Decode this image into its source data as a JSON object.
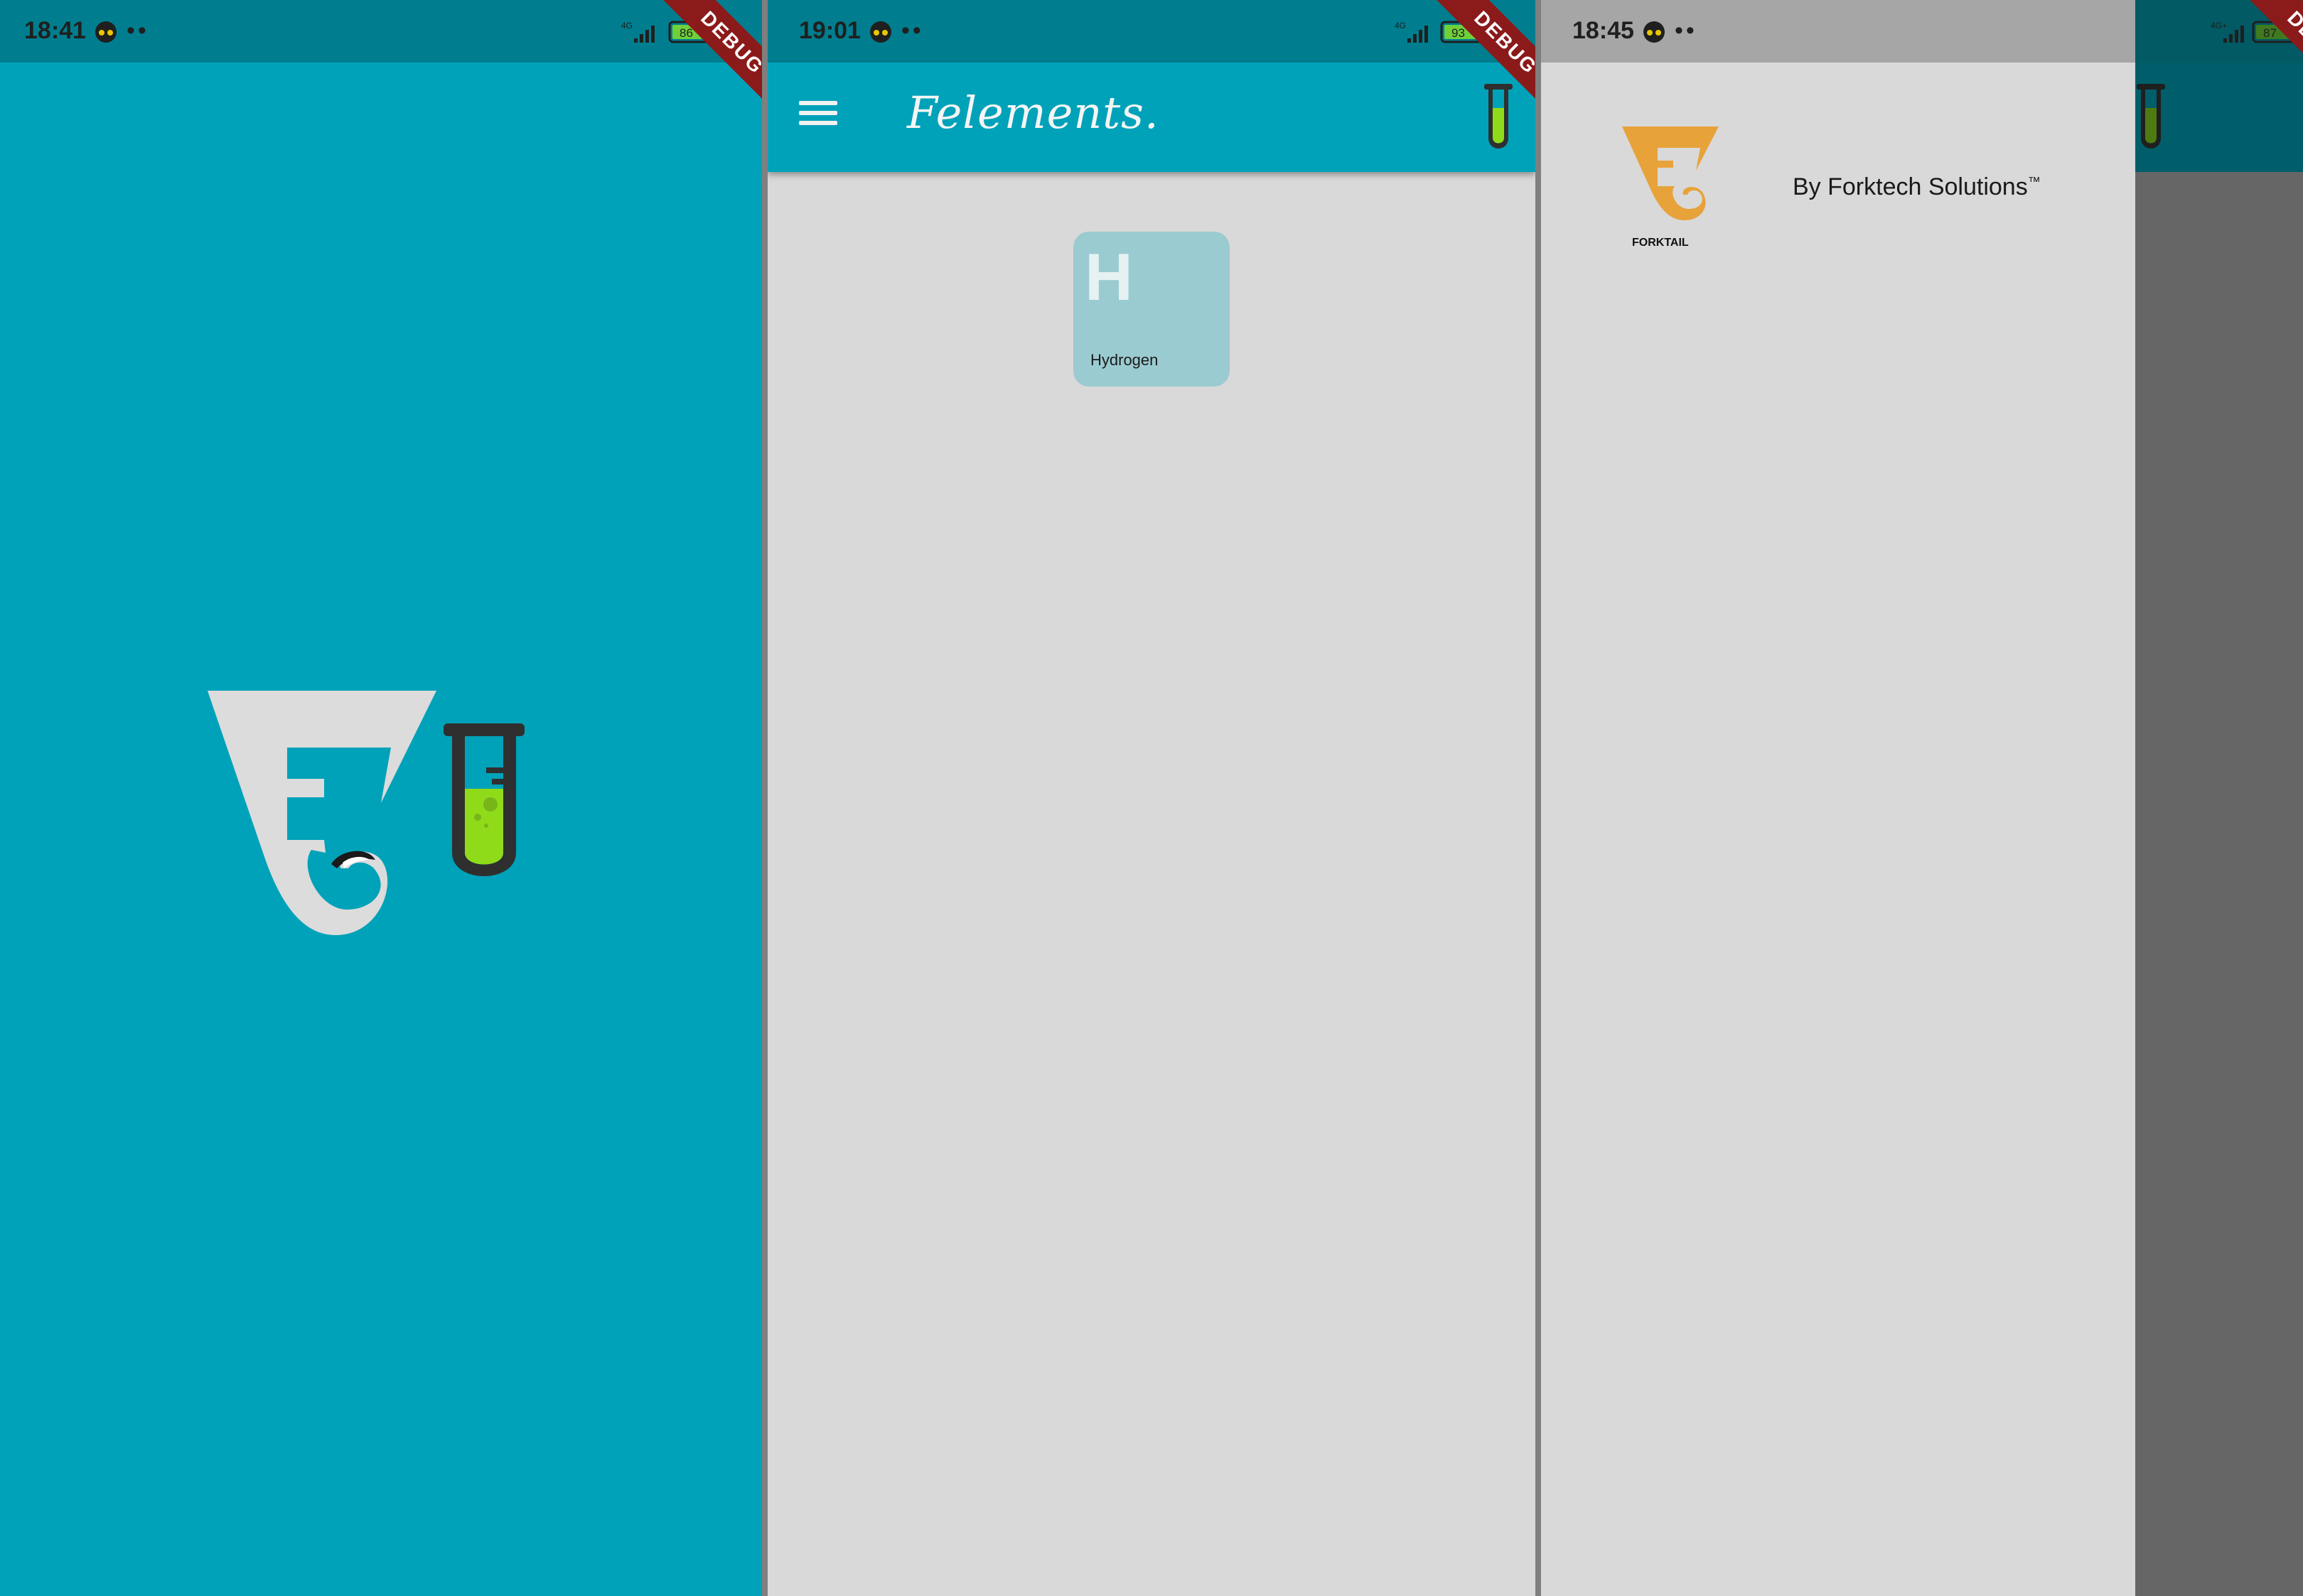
{
  "screens": [
    {
      "name": "splash",
      "status": {
        "time": "18:41",
        "dots": "••",
        "network": "4G",
        "battery": "86"
      },
      "debug_banner": "DEBUG"
    },
    {
      "name": "home",
      "status": {
        "time": "19:01",
        "dots": "••",
        "network": "4G",
        "battery": "93"
      },
      "debug_banner": "DEBUG",
      "appbar": {
        "title": "Felements."
      },
      "elements": [
        {
          "symbol": "H",
          "name": "Hydrogen"
        }
      ]
    },
    {
      "name": "drawer",
      "status": {
        "time": "18:45",
        "dots": "••",
        "network": "4G+",
        "battery": "87"
      },
      "debug_banner": "DEBUG",
      "drawer": {
        "logo_text": "FORKTAIL",
        "byline": "By Forktech Solutions",
        "trademark": "™"
      }
    }
  ],
  "colors": {
    "primary": "#00A2B9",
    "status_bar": "#007E8F",
    "background": "#D9D9D9",
    "tile": "#9ACBD1",
    "logo_orange": "#E8A23A",
    "test_tube_liquid": "#8FDB1A",
    "debug_banner": "#8B1A1A"
  }
}
